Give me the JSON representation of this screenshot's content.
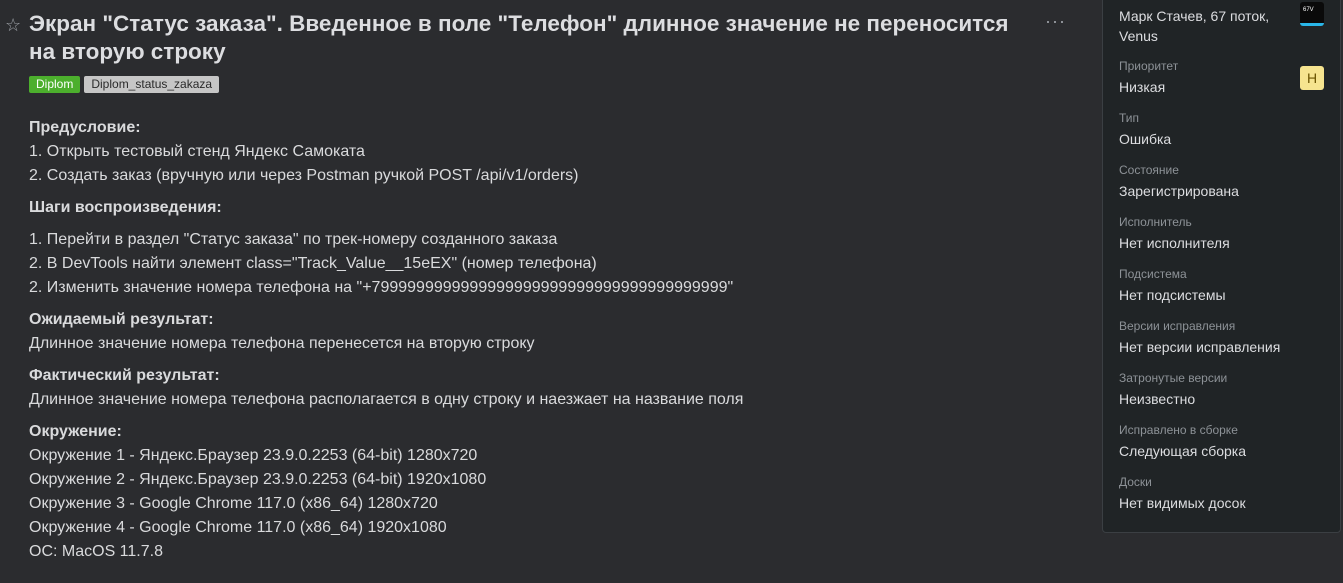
{
  "issue": {
    "title": "Экран \"Статус заказа\". Введенное в поле \"Телефон\" длинное значение не переносится на вторую строку",
    "tags": [
      "Diplom",
      "Diplom_status_zakaza"
    ],
    "more_label": "···",
    "star_label": "☆"
  },
  "description": {
    "precondition_heading": "Предусловие:",
    "precondition_lines": [
      "1. Открыть тестовый стенд Яндекс Самоката",
      "2. Создать заказ (вручную или через Postman ручкой POST /api/v1/orders)"
    ],
    "steps_heading": "Шаги воспроизведения:",
    "steps_lines": [
      "1. Перейти в раздел \"Статус заказа\" по трек-номеру созданного заказа",
      "2. В DevTools найти элемент class=\"Track_Value__15eEX\" (номер телефона)",
      "2. Изменить значение номера телефона на \"+7999999999999999999999999999999999999999\""
    ],
    "expected_heading": "Ожидаемый результат:",
    "expected_lines": [
      "Длинное значение номера телефона перенесется на вторую строку"
    ],
    "actual_heading": "Фактический результат:",
    "actual_lines": [
      "Длинное значение номера телефона располагается в одну строку и наезжает на название поля"
    ],
    "env_heading": "Окружение:",
    "env_lines": [
      "Окружение 1 - Яндекс.Браузер 23.9.0.2253 (64-bit) 1280x720",
      "Окружение 2 - Яндекс.Браузер 23.9.0.2253 (64-bit) 1920x1080",
      "Окружение 3 - Google Chrome 117.0 (x86_64) 1280x720",
      "Окружение 4 - Google Chrome 117.0 (x86_64) 1920x1080",
      "ОС: MacOS 11.7.8"
    ]
  },
  "sidebar": {
    "assignee_line1": "Марк Стачев, 67 поток,",
    "assignee_line2": "Venus",
    "avatar_text": "67V",
    "priority_badge": "Н",
    "fields": [
      {
        "label": "Приоритет",
        "value": "Низкая"
      },
      {
        "label": "Тип",
        "value": "Ошибка"
      },
      {
        "label": "Состояние",
        "value": "Зарегистрирована"
      },
      {
        "label": "Исполнитель",
        "value": "Нет исполнителя"
      },
      {
        "label": "Подсистема",
        "value": "Нет подсистемы"
      },
      {
        "label": "Версии исправления",
        "value": "Нет версии исправления"
      },
      {
        "label": "Затронутые версии",
        "value": "Неизвестно"
      },
      {
        "label": "Исправлено в сборке",
        "value": "Следующая сборка"
      },
      {
        "label": "Доски",
        "value": "Нет видимых досок"
      }
    ]
  }
}
